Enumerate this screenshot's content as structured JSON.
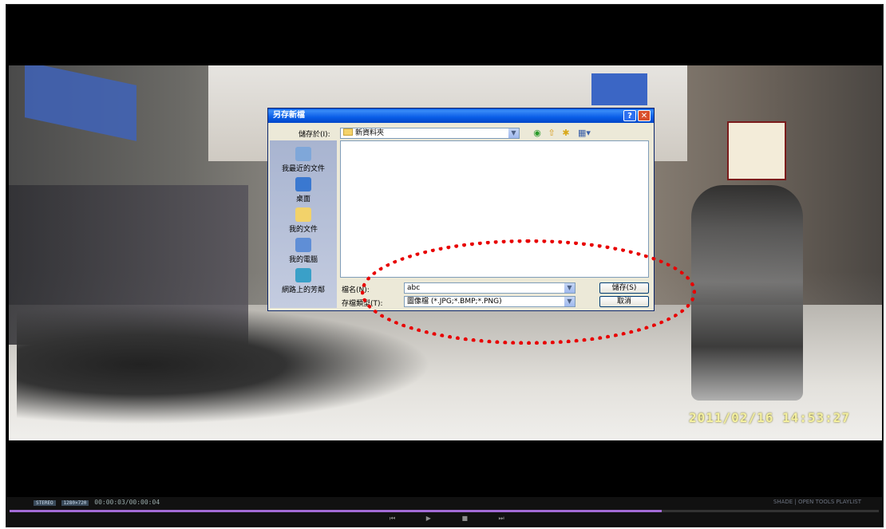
{
  "dialog": {
    "title": "另存新檔",
    "help_btn": "?",
    "close_btn": "✕",
    "save_in_label": "儲存於(I):",
    "save_in_value": "新資料夾",
    "places": [
      "我最近的文件",
      "桌面",
      "我的文件",
      "我的電腦",
      "網路上的芳鄰"
    ],
    "filename_label": "檔名(N):",
    "filename_value": "abc",
    "filetype_label": "存檔類型(T):",
    "filetype_value": "圖像檔 (*.JPG;*.BMP;*.PNG)",
    "save_button": "儲存(S)",
    "cancel_button": "取消"
  },
  "video": {
    "timestamp": "2011/02/16  14:53:27"
  },
  "player": {
    "chip1": "STEREO",
    "chip2": "1280×720",
    "time": "00:00:03/00:00:04",
    "right_menu": "SHADE | OPEN  TOOLS  PLAYLIST",
    "progress": 0.75,
    "transport": "⏮ ▶ ■ ⏭"
  },
  "colors": {
    "title_blue": "#0a5ee8",
    "annotation_red": "#e80000",
    "progress_purple": "#a36cd6"
  }
}
